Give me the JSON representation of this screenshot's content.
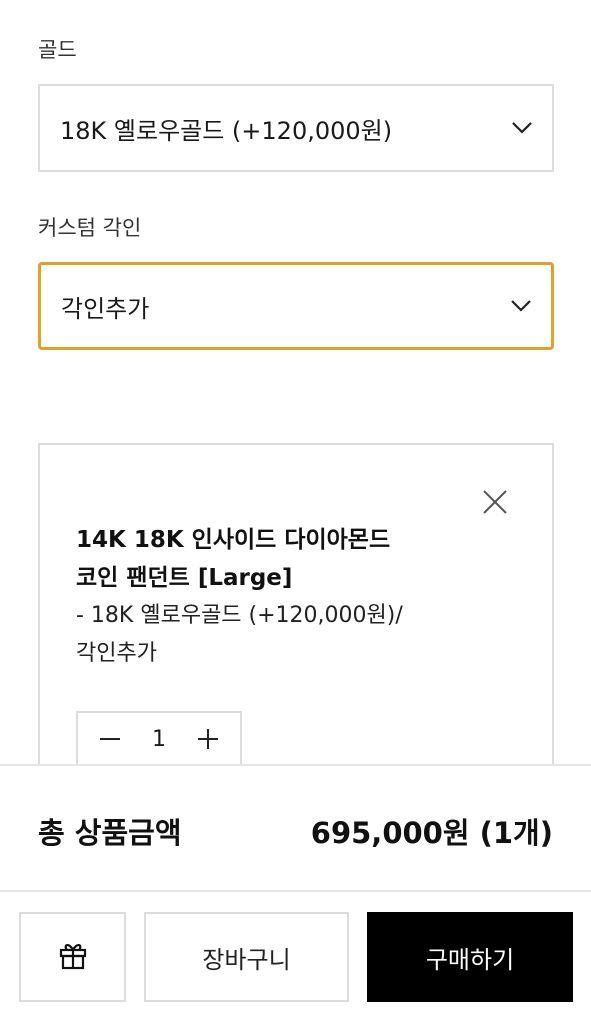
{
  "gold": {
    "label": "골드",
    "selected": "18K 옐로우골드 (+120,000원)"
  },
  "engraving": {
    "label": "커스텀 각인",
    "selected": "각인추가"
  },
  "selected_item": {
    "title": "14K 18K 인사이드 다이아몬드 코인 팬던트 [Large]",
    "options": "- 18K 옐로우골드 (+120,000원)/각인추가",
    "quantity": "1"
  },
  "summary": {
    "total_label": "총 상품금액",
    "total_value": "695,000원 (1개)"
  },
  "actions": {
    "cart_label": "장바구니",
    "buy_label": "구매하기"
  },
  "icons": {
    "chevron": "chevron-down-icon",
    "close": "close-icon",
    "minus": "minus-icon",
    "plus": "plus-icon",
    "gift": "gift-icon"
  },
  "colors": {
    "focus_border": "#e0a21f",
    "buy_button_bg": "#000000",
    "border": "#dcdcdc"
  }
}
